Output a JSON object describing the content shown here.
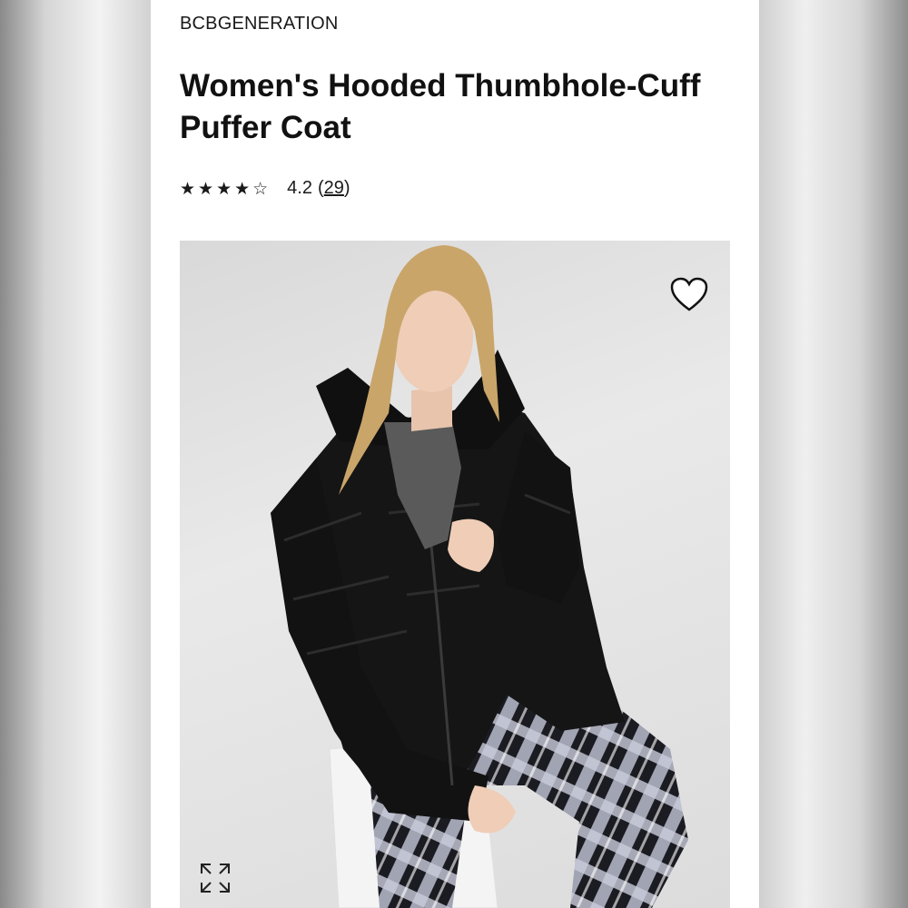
{
  "product": {
    "brand": "BCBGENERATION",
    "title": "Women's Hooded Thumbhole-Cuff Puffer Coat",
    "rating": {
      "stars_display": "★★★★☆",
      "value": "4.2",
      "open_paren": "(",
      "count": "29",
      "close_paren": ")"
    }
  },
  "image": {
    "subject": "model wearing black hooded puffer coat, grey turtleneck and plaid pants",
    "wishlist_icon": "heart-outline-icon",
    "expand_icon": "expand-arrows-icon"
  },
  "colors": {
    "panel_bg": "#ffffff",
    "text": "#111111",
    "photo_bg": "#e2e2e2",
    "coat": "#141414"
  }
}
